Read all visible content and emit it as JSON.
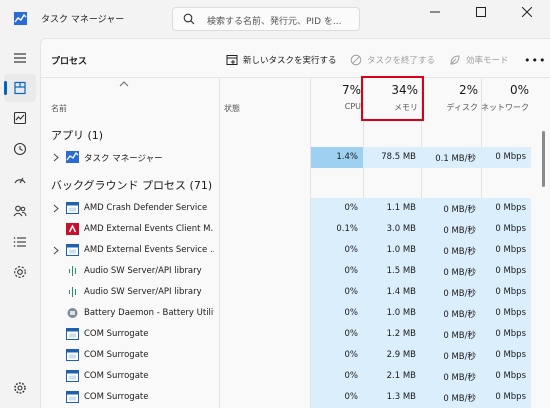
{
  "app": {
    "title": "タスク マネージャー",
    "accent": "#0067c0"
  },
  "search": {
    "placeholder": "検索する名前、発行元、PID を..."
  },
  "nav": [
    {
      "icon": "hamburger-icon"
    },
    {
      "icon": "processes-icon",
      "active": true
    },
    {
      "icon": "performance-icon"
    },
    {
      "icon": "app-history-icon"
    },
    {
      "icon": "startup-icon"
    },
    {
      "icon": "users-icon"
    },
    {
      "icon": "details-icon"
    },
    {
      "icon": "services-icon"
    },
    {
      "icon": "settings-icon"
    }
  ],
  "page": {
    "title": "プロセス"
  },
  "toolbar": {
    "new_task": "新しいタスクを実行する",
    "end_task": "タスクを終了する",
    "efficiency": "効率モード",
    "more": "•••"
  },
  "columns": {
    "name": "名前",
    "status": "状態",
    "cpu": {
      "pct": "7%",
      "label": "CPU"
    },
    "memory": {
      "pct": "34%",
      "label": "メモリ"
    },
    "disk": {
      "pct": "2%",
      "label": "ディスク"
    },
    "network": {
      "pct": "0%",
      "label": "ネットワーク"
    }
  },
  "groups": {
    "apps": "アプリ (1)",
    "background": "バックグラウンド プロセス (71)"
  },
  "app_rows": [
    {
      "name": "タスク マネージャー",
      "cpu": "1.4%",
      "mem": "78.5 MB",
      "disk": "0.1 MB/秒",
      "net": "0 Mbps",
      "expandable": true
    }
  ],
  "bg_rows": [
    {
      "name": "AMD Crash Defender Service",
      "cpu": "0%",
      "mem": "1.1 MB",
      "disk": "0 MB/秒",
      "net": "0 Mbps",
      "expandable": true,
      "icon": "window-icon"
    },
    {
      "name": "AMD External Events Client M...",
      "cpu": "0.1%",
      "mem": "3.0 MB",
      "disk": "0 MB/秒",
      "net": "0 Mbps",
      "expandable": false,
      "icon": "amd-icon"
    },
    {
      "name": "AMD External Events Service ...",
      "cpu": "0%",
      "mem": "1.0 MB",
      "disk": "0 MB/秒",
      "net": "0 Mbps",
      "expandable": true,
      "icon": "window-icon"
    },
    {
      "name": "Audio SW Server/API library",
      "cpu": "0%",
      "mem": "1.5 MB",
      "disk": "0 MB/秒",
      "net": "0 Mbps",
      "expandable": false,
      "icon": "audio-icon"
    },
    {
      "name": "Audio SW Server/API library",
      "cpu": "0%",
      "mem": "1.4 MB",
      "disk": "0 MB/秒",
      "net": "0 Mbps",
      "expandable": false,
      "icon": "audio-icon"
    },
    {
      "name": "Battery Daemon - Battery Utility",
      "cpu": "0%",
      "mem": "1.0 MB",
      "disk": "0 MB/秒",
      "net": "0 Mbps",
      "expandable": false,
      "icon": "battery-icon"
    },
    {
      "name": "COM Surrogate",
      "cpu": "0%",
      "mem": "1.2 MB",
      "disk": "0 MB/秒",
      "net": "0 Mbps",
      "expandable": false,
      "icon": "window-icon"
    },
    {
      "name": "COM Surrogate",
      "cpu": "0%",
      "mem": "2.9 MB",
      "disk": "0 MB/秒",
      "net": "0 Mbps",
      "expandable": false,
      "icon": "window-icon"
    },
    {
      "name": "COM Surrogate",
      "cpu": "0%",
      "mem": "2.1 MB",
      "disk": "0 MB/秒",
      "net": "0 Mbps",
      "expandable": false,
      "icon": "window-icon"
    },
    {
      "name": "COM Surrogate",
      "cpu": "0%",
      "mem": "1.3 MB",
      "disk": "0 MB/秒",
      "net": "0 Mbps",
      "expandable": false,
      "icon": "window-icon"
    }
  ]
}
